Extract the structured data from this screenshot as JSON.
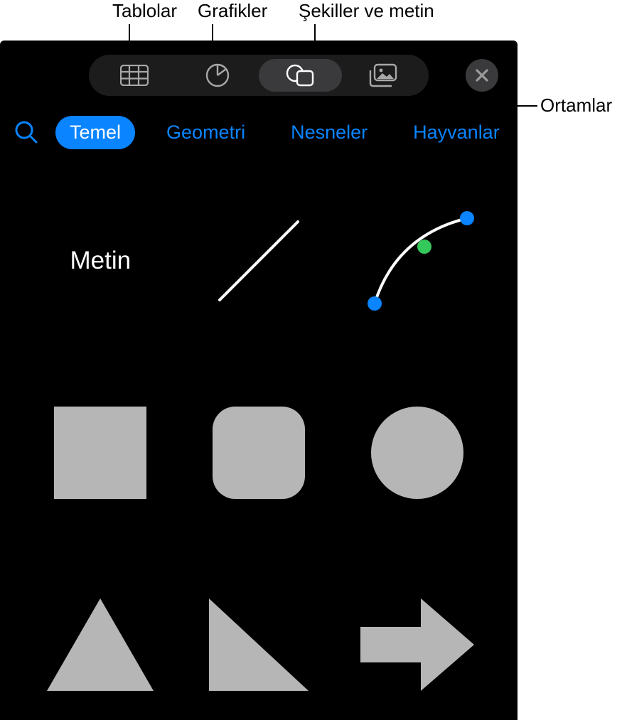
{
  "callouts": {
    "tables": "Tablolar",
    "charts": "Grafikler",
    "shapes_text": "Şekiller ve metin",
    "media": "Ortamlar"
  },
  "toolbar": {
    "tables_icon": "tables-icon",
    "charts_icon": "chart-icon",
    "shapes_icon": "shapes-icon",
    "media_icon": "media-icon",
    "close_icon": "close-icon",
    "active": "shapes"
  },
  "categories": {
    "search_icon": "search-icon",
    "items": [
      {
        "label": "Temel",
        "active": true
      },
      {
        "label": "Geometri",
        "active": false
      },
      {
        "label": "Nesneler",
        "active": false
      },
      {
        "label": "Hayvanlar",
        "active": false
      }
    ]
  },
  "shapes": {
    "text_label": "Metin",
    "items": [
      "text",
      "line",
      "curve",
      "square",
      "rounded-square",
      "circle",
      "triangle",
      "right-triangle",
      "arrow-right"
    ]
  },
  "colors": {
    "shape_fill": "#b6b6b6",
    "accent": "#0a84ff",
    "toolbar_bg": "#1c1c1d",
    "active_bg": "#3a3a3c"
  }
}
